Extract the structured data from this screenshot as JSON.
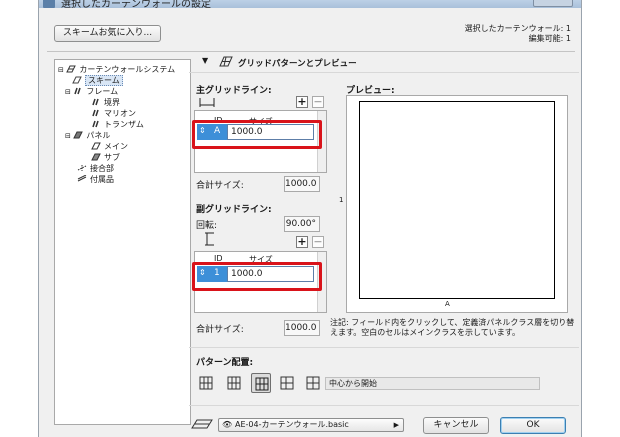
{
  "window": {
    "title": "選択したカーテンウォールの設定"
  },
  "favorites_button": "スキームお気に入り...",
  "status": {
    "selected": "選択したカーテンウォール: 1",
    "editable": "編集可能: 1"
  },
  "tree": {
    "items": [
      {
        "label": "カーテンウォールシステム",
        "icon": "curtain-wall-icon"
      },
      {
        "label": "スキーム",
        "icon": "scheme-icon",
        "selected": true
      },
      {
        "label": "フレーム",
        "icon": "frame-icon"
      },
      {
        "label": "境界",
        "icon": "boundary-icon"
      },
      {
        "label": "マリオン",
        "icon": "mullion-icon"
      },
      {
        "label": "トランザム",
        "icon": "transom-icon"
      },
      {
        "label": "パネル",
        "icon": "panel-icon"
      },
      {
        "label": "メイン",
        "icon": "main-panel-icon"
      },
      {
        "label": "サブ",
        "icon": "sub-panel-icon"
      },
      {
        "label": "接合部",
        "icon": "junction-icon"
      },
      {
        "label": "付属品",
        "icon": "accessory-icon"
      }
    ]
  },
  "panel": {
    "header": "グリッドパターンとプレビュー",
    "main_grid": {
      "title": "主グリッドライン:",
      "col_id": "ID",
      "col_size": "サイズ",
      "row_id": "A",
      "row_value": "1000.0",
      "total_label": "合計サイズ:",
      "total_value": "1000.0"
    },
    "sub_grid": {
      "title": "副グリッドライン:",
      "rotation_label": "回転:",
      "rotation_value": "90.00°",
      "col_id": "ID",
      "col_size": "サイズ",
      "row_id": "1",
      "row_value": "1000.0",
      "total_label": "合計サイズ:",
      "total_value": "1000.0"
    },
    "preview": {
      "title": "プレビュー:",
      "axis_left": "1",
      "axis_bottom": "A",
      "note": "注記: フィールド内をクリックして、定義済パネルクラス層を切り替えます。空白のセルはメインクラスを示しています。"
    },
    "pattern": {
      "title": "パターン配置:",
      "start_field": "中心から開始"
    }
  },
  "footer": {
    "layer_combo": "AE-04-カーテンウォール.basic",
    "cancel": "キャンセル",
    "ok": "OK"
  },
  "colors": {
    "highlight": "#d9131a",
    "row_selected": "#3d8fd8"
  }
}
